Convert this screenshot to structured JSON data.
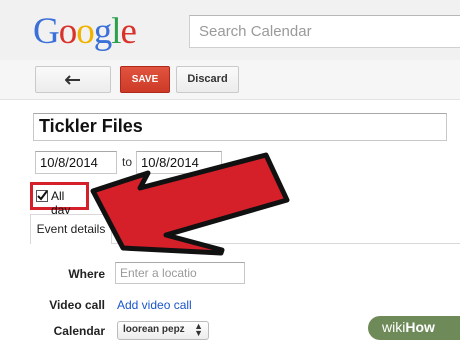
{
  "header": {
    "logo_letters": [
      {
        "char": "G",
        "color": "#3b70d8"
      },
      {
        "char": "o",
        "color": "#d8322a"
      },
      {
        "char": "o",
        "color": "#f0b400"
      },
      {
        "char": "g",
        "color": "#3b70d8"
      },
      {
        "char": "l",
        "color": "#2aa04a"
      },
      {
        "char": "e",
        "color": "#d8322a"
      }
    ],
    "search_placeholder": "Search Calendar"
  },
  "toolbar": {
    "back_icon": "arrow-left-icon",
    "save_label": "SAVE",
    "discard_label": "Discard"
  },
  "event": {
    "title": "Tickler Files",
    "start_date": "10/8/2014",
    "to_label": "to",
    "end_date": "10/8/2014",
    "all_day_label": "All day",
    "all_day_checked": true
  },
  "tabs": {
    "event_details": "Event details"
  },
  "details": {
    "where_label": "Where",
    "where_placeholder": "Enter a locatio",
    "video_call_label": "Video call",
    "add_video_call_link": "Add video call",
    "calendar_label": "Calendar",
    "calendar_value": "loorean pepz"
  },
  "annotation": {
    "arrow_color": "#d5202a",
    "highlight_color": "#d5202a"
  },
  "watermark": {
    "wiki": "wiki",
    "how": "How"
  }
}
